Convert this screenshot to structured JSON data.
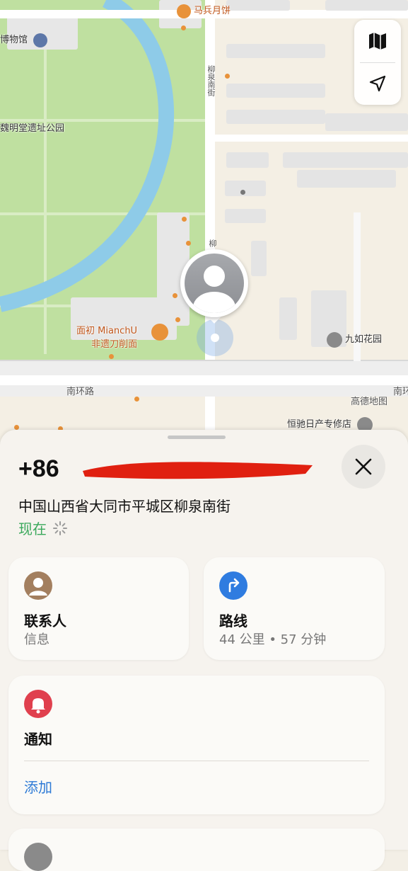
{
  "map": {
    "poi_labels": {
      "museum": "博物馆",
      "mooncake": "马兵月饼",
      "park": "魏明堂遗址公园",
      "noodle_line1": "面初 MianchU",
      "noodle_line2": "非遗刀削面",
      "garden": "九如花园",
      "realestate": "恒驰日产专修店"
    },
    "street_labels": {
      "liuquan": "柳泉南街",
      "liuquan_short": "柳",
      "nanhuan": "南环路",
      "nanhuan_right": "南环",
      "amap": "高德地图"
    },
    "controls": {
      "map_icon": "map-icon",
      "location_icon": "location-arrow-icon"
    }
  },
  "sheet": {
    "phone_prefix": "+86",
    "address": "中国山西省大同市平城区柳泉南街",
    "time": "现在",
    "contact_card": {
      "title": "联系人",
      "subtitle": "信息"
    },
    "route_card": {
      "title": "路线",
      "subtitle": "44 公里 • 57 分钟"
    },
    "notify_card": {
      "title": "通知",
      "action": "添加"
    }
  },
  "colors": {
    "accent_blue": "#2d7ad6",
    "green": "#3aa85b",
    "bell_red": "#e0404e",
    "contact_brown": "#a37f5f",
    "redaction": "#e02010"
  }
}
